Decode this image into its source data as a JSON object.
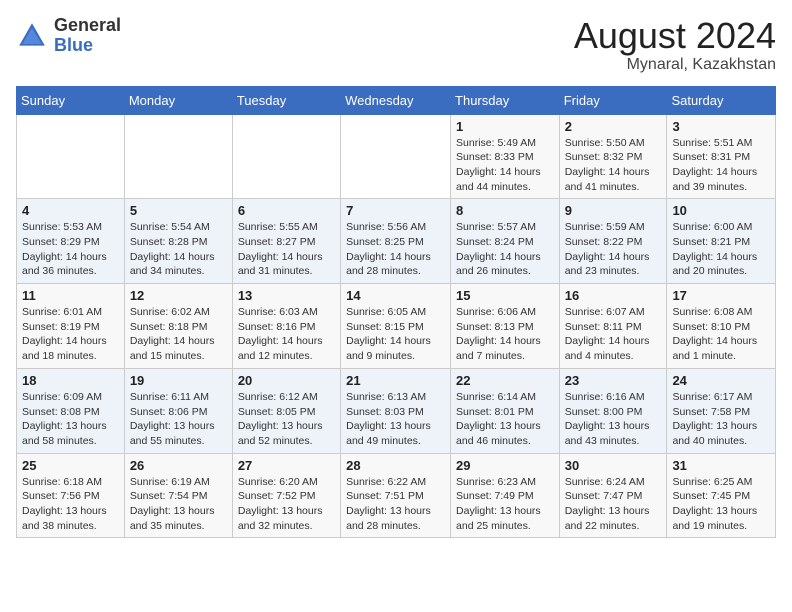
{
  "header": {
    "logo_general": "General",
    "logo_blue": "Blue",
    "title": "August 2024",
    "location": "Mynaral, Kazakhstan"
  },
  "days_of_week": [
    "Sunday",
    "Monday",
    "Tuesday",
    "Wednesday",
    "Thursday",
    "Friday",
    "Saturday"
  ],
  "weeks": [
    [
      {
        "day": "",
        "sunrise": "",
        "sunset": "",
        "daylight": ""
      },
      {
        "day": "",
        "sunrise": "",
        "sunset": "",
        "daylight": ""
      },
      {
        "day": "",
        "sunrise": "",
        "sunset": "",
        "daylight": ""
      },
      {
        "day": "",
        "sunrise": "",
        "sunset": "",
        "daylight": ""
      },
      {
        "day": "1",
        "sunrise": "Sunrise: 5:49 AM",
        "sunset": "Sunset: 8:33 PM",
        "daylight": "Daylight: 14 hours and 44 minutes."
      },
      {
        "day": "2",
        "sunrise": "Sunrise: 5:50 AM",
        "sunset": "Sunset: 8:32 PM",
        "daylight": "Daylight: 14 hours and 41 minutes."
      },
      {
        "day": "3",
        "sunrise": "Sunrise: 5:51 AM",
        "sunset": "Sunset: 8:31 PM",
        "daylight": "Daylight: 14 hours and 39 minutes."
      }
    ],
    [
      {
        "day": "4",
        "sunrise": "Sunrise: 5:53 AM",
        "sunset": "Sunset: 8:29 PM",
        "daylight": "Daylight: 14 hours and 36 minutes."
      },
      {
        "day": "5",
        "sunrise": "Sunrise: 5:54 AM",
        "sunset": "Sunset: 8:28 PM",
        "daylight": "Daylight: 14 hours and 34 minutes."
      },
      {
        "day": "6",
        "sunrise": "Sunrise: 5:55 AM",
        "sunset": "Sunset: 8:27 PM",
        "daylight": "Daylight: 14 hours and 31 minutes."
      },
      {
        "day": "7",
        "sunrise": "Sunrise: 5:56 AM",
        "sunset": "Sunset: 8:25 PM",
        "daylight": "Daylight: 14 hours and 28 minutes."
      },
      {
        "day": "8",
        "sunrise": "Sunrise: 5:57 AM",
        "sunset": "Sunset: 8:24 PM",
        "daylight": "Daylight: 14 hours and 26 minutes."
      },
      {
        "day": "9",
        "sunrise": "Sunrise: 5:59 AM",
        "sunset": "Sunset: 8:22 PM",
        "daylight": "Daylight: 14 hours and 23 minutes."
      },
      {
        "day": "10",
        "sunrise": "Sunrise: 6:00 AM",
        "sunset": "Sunset: 8:21 PM",
        "daylight": "Daylight: 14 hours and 20 minutes."
      }
    ],
    [
      {
        "day": "11",
        "sunrise": "Sunrise: 6:01 AM",
        "sunset": "Sunset: 8:19 PM",
        "daylight": "Daylight: 14 hours and 18 minutes."
      },
      {
        "day": "12",
        "sunrise": "Sunrise: 6:02 AM",
        "sunset": "Sunset: 8:18 PM",
        "daylight": "Daylight: 14 hours and 15 minutes."
      },
      {
        "day": "13",
        "sunrise": "Sunrise: 6:03 AM",
        "sunset": "Sunset: 8:16 PM",
        "daylight": "Daylight: 14 hours and 12 minutes."
      },
      {
        "day": "14",
        "sunrise": "Sunrise: 6:05 AM",
        "sunset": "Sunset: 8:15 PM",
        "daylight": "Daylight: 14 hours and 9 minutes."
      },
      {
        "day": "15",
        "sunrise": "Sunrise: 6:06 AM",
        "sunset": "Sunset: 8:13 PM",
        "daylight": "Daylight: 14 hours and 7 minutes."
      },
      {
        "day": "16",
        "sunrise": "Sunrise: 6:07 AM",
        "sunset": "Sunset: 8:11 PM",
        "daylight": "Daylight: 14 hours and 4 minutes."
      },
      {
        "day": "17",
        "sunrise": "Sunrise: 6:08 AM",
        "sunset": "Sunset: 8:10 PM",
        "daylight": "Daylight: 14 hours and 1 minute."
      }
    ],
    [
      {
        "day": "18",
        "sunrise": "Sunrise: 6:09 AM",
        "sunset": "Sunset: 8:08 PM",
        "daylight": "Daylight: 13 hours and 58 minutes."
      },
      {
        "day": "19",
        "sunrise": "Sunrise: 6:11 AM",
        "sunset": "Sunset: 8:06 PM",
        "daylight": "Daylight: 13 hours and 55 minutes."
      },
      {
        "day": "20",
        "sunrise": "Sunrise: 6:12 AM",
        "sunset": "Sunset: 8:05 PM",
        "daylight": "Daylight: 13 hours and 52 minutes."
      },
      {
        "day": "21",
        "sunrise": "Sunrise: 6:13 AM",
        "sunset": "Sunset: 8:03 PM",
        "daylight": "Daylight: 13 hours and 49 minutes."
      },
      {
        "day": "22",
        "sunrise": "Sunrise: 6:14 AM",
        "sunset": "Sunset: 8:01 PM",
        "daylight": "Daylight: 13 hours and 46 minutes."
      },
      {
        "day": "23",
        "sunrise": "Sunrise: 6:16 AM",
        "sunset": "Sunset: 8:00 PM",
        "daylight": "Daylight: 13 hours and 43 minutes."
      },
      {
        "day": "24",
        "sunrise": "Sunrise: 6:17 AM",
        "sunset": "Sunset: 7:58 PM",
        "daylight": "Daylight: 13 hours and 40 minutes."
      }
    ],
    [
      {
        "day": "25",
        "sunrise": "Sunrise: 6:18 AM",
        "sunset": "Sunset: 7:56 PM",
        "daylight": "Daylight: 13 hours and 38 minutes."
      },
      {
        "day": "26",
        "sunrise": "Sunrise: 6:19 AM",
        "sunset": "Sunset: 7:54 PM",
        "daylight": "Daylight: 13 hours and 35 minutes."
      },
      {
        "day": "27",
        "sunrise": "Sunrise: 6:20 AM",
        "sunset": "Sunset: 7:52 PM",
        "daylight": "Daylight: 13 hours and 32 minutes."
      },
      {
        "day": "28",
        "sunrise": "Sunrise: 6:22 AM",
        "sunset": "Sunset: 7:51 PM",
        "daylight": "Daylight: 13 hours and 28 minutes."
      },
      {
        "day": "29",
        "sunrise": "Sunrise: 6:23 AM",
        "sunset": "Sunset: 7:49 PM",
        "daylight": "Daylight: 13 hours and 25 minutes."
      },
      {
        "day": "30",
        "sunrise": "Sunrise: 6:24 AM",
        "sunset": "Sunset: 7:47 PM",
        "daylight": "Daylight: 13 hours and 22 minutes."
      },
      {
        "day": "31",
        "sunrise": "Sunrise: 6:25 AM",
        "sunset": "Sunset: 7:45 PM",
        "daylight": "Daylight: 13 hours and 19 minutes."
      }
    ]
  ]
}
